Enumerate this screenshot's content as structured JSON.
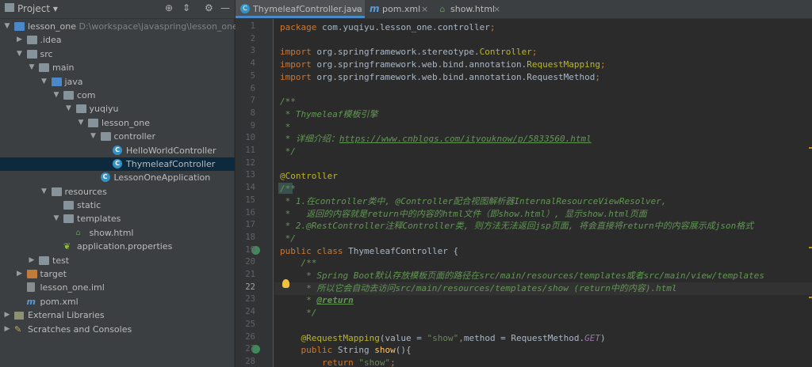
{
  "project_panel": {
    "title": "Project",
    "tree": [
      {
        "label": "lesson_one",
        "path": "D:\\workspace\\javaspring\\lesson_one",
        "icon": "module-folder-icon",
        "arrow": "▼"
      },
      {
        "label": ".idea",
        "icon": "folder-icon",
        "arrow": "▶"
      },
      {
        "label": "src",
        "icon": "folder-icon",
        "arrow": "▼"
      },
      {
        "label": "main",
        "icon": "folder-icon",
        "arrow": "▼"
      },
      {
        "label": "java",
        "icon": "source-folder-icon",
        "arrow": "▼"
      },
      {
        "label": "com",
        "icon": "package-icon",
        "arrow": "▼"
      },
      {
        "label": "yuqiyu",
        "icon": "package-icon",
        "arrow": "▼"
      },
      {
        "label": "lesson_one",
        "icon": "package-icon",
        "arrow": "▼"
      },
      {
        "label": "controller",
        "icon": "package-icon",
        "arrow": "▼"
      },
      {
        "label": "HelloWorldController",
        "icon": "class-icon",
        "arrow": ""
      },
      {
        "label": "ThymeleafController",
        "icon": "class-icon",
        "arrow": "",
        "selected": true
      },
      {
        "label": "LessonOneApplication",
        "icon": "spring-class-icon",
        "arrow": ""
      },
      {
        "label": "resources",
        "icon": "resources-folder-icon",
        "arrow": "▼"
      },
      {
        "label": "static",
        "icon": "folder-icon",
        "arrow": ""
      },
      {
        "label": "templates",
        "icon": "folder-icon",
        "arrow": "▼"
      },
      {
        "label": "show.html",
        "icon": "html-file-icon",
        "arrow": ""
      },
      {
        "label": "application.properties",
        "icon": "properties-file-icon",
        "arrow": ""
      },
      {
        "label": "test",
        "icon": "folder-icon",
        "arrow": "▶"
      },
      {
        "label": "target",
        "icon": "excluded-folder-icon",
        "arrow": "▶"
      },
      {
        "label": "lesson_one.iml",
        "icon": "iml-file-icon",
        "arrow": ""
      },
      {
        "label": "pom.xml",
        "icon": "maven-file-icon",
        "arrow": ""
      },
      {
        "label": "External Libraries",
        "icon": "library-icon",
        "arrow": "▶"
      },
      {
        "label": "Scratches and Consoles",
        "icon": "scratch-icon",
        "arrow": "▶"
      }
    ]
  },
  "tabs": [
    {
      "label": "ThymeleafController.java",
      "active": true
    },
    {
      "label": "pom.xml",
      "active": false
    },
    {
      "label": "show.html",
      "active": false
    }
  ],
  "editor": {
    "current_line": 22,
    "lines": [
      {
        "n": "1",
        "segs": [
          {
            "c": "kw",
            "t": "package "
          },
          {
            "c": "",
            "t": "com.yuqiyu.lesson_one.controller"
          },
          {
            "c": "kw",
            "t": ";"
          }
        ]
      },
      {
        "n": "2",
        "segs": []
      },
      {
        "n": "3",
        "segs": [
          {
            "c": "kw",
            "t": "import "
          },
          {
            "c": "",
            "t": "org.springframework.stereotype."
          },
          {
            "c": "ann",
            "t": "Controller"
          },
          {
            "c": "kw",
            "t": ";"
          }
        ]
      },
      {
        "n": "4",
        "segs": [
          {
            "c": "kw",
            "t": "import "
          },
          {
            "c": "",
            "t": "org.springframework.web.bind.annotation."
          },
          {
            "c": "ann",
            "t": "RequestMapping"
          },
          {
            "c": "kw",
            "t": ";"
          }
        ]
      },
      {
        "n": "5",
        "segs": [
          {
            "c": "kw",
            "t": "import "
          },
          {
            "c": "",
            "t": "org.springframework.web.bind.annotation.RequestMethod"
          },
          {
            "c": "kw",
            "t": ";"
          }
        ]
      },
      {
        "n": "6",
        "segs": []
      },
      {
        "n": "7",
        "segs": [
          {
            "c": "cm",
            "t": "/**"
          }
        ]
      },
      {
        "n": "8",
        "segs": [
          {
            "c": "cm",
            "t": " * Thymeleaf模板引擎"
          }
        ]
      },
      {
        "n": "9",
        "segs": [
          {
            "c": "cm",
            "t": " *"
          }
        ]
      },
      {
        "n": "10",
        "segs": [
          {
            "c": "cm",
            "t": " * 详细介绍："
          },
          {
            "c": "lnk",
            "t": "https://www.cnblogs.com/ityouknow/p/5833560.html"
          }
        ]
      },
      {
        "n": "11",
        "segs": [
          {
            "c": "cm",
            "t": " */"
          }
        ]
      },
      {
        "n": "12",
        "segs": []
      },
      {
        "n": "13",
        "segs": [
          {
            "c": "ann",
            "t": "@Controller"
          }
        ]
      },
      {
        "n": "14",
        "segs": [
          {
            "c": "cm",
            "t": "/**"
          }
        ]
      },
      {
        "n": "15",
        "segs": [
          {
            "c": "cm",
            "t": " * 1.在controller类中, @Controller配合视图解析器InternalResourceViewResolver,"
          }
        ]
      },
      {
        "n": "16",
        "segs": [
          {
            "c": "cm",
            "t": " *   返回的内容就是return中的内容的html文件（即show.html）, 显示show.html页面"
          }
        ]
      },
      {
        "n": "17",
        "segs": [
          {
            "c": "cm",
            "t": " * 2.@RestController注释Controller类, 则方法无法返回jsp页面, 将会直接将return中的内容展示成json格式"
          }
        ]
      },
      {
        "n": "18",
        "segs": [
          {
            "c": "cm",
            "t": " */"
          }
        ]
      },
      {
        "n": "19",
        "segs": [
          {
            "c": "kw",
            "t": "public class "
          },
          {
            "c": "",
            "t": "ThymeleafController {"
          }
        ]
      },
      {
        "n": "20",
        "segs": [
          {
            "c": "cm",
            "t": "    /**"
          }
        ]
      },
      {
        "n": "21",
        "segs": [
          {
            "c": "cm",
            "t": "     * Spring Boot默认存放模板页面的路径在src/main/resources/templates或者src/main/view/templates"
          }
        ]
      },
      {
        "n": "22",
        "segs": [
          {
            "c": "cm",
            "t": "     * 所以它会自动去访问src/main/resources/templates/show (return中的内容).html"
          }
        ]
      },
      {
        "n": "23",
        "segs": [
          {
            "c": "cm",
            "t": "     * "
          },
          {
            "c": "tag",
            "t": "@return"
          }
        ]
      },
      {
        "n": "24",
        "segs": [
          {
            "c": "cm",
            "t": "     */"
          }
        ]
      },
      {
        "n": "25",
        "segs": []
      },
      {
        "n": "26",
        "segs": [
          {
            "c": "ann",
            "t": "    @RequestMapping"
          },
          {
            "c": "",
            "t": "(value = "
          },
          {
            "c": "str",
            "t": "\"show\""
          },
          {
            "c": "kw",
            "t": ","
          },
          {
            "c": "",
            "t": "method = RequestMethod."
          },
          {
            "c": "cnst",
            "t": "GET"
          },
          {
            "c": "",
            "t": ")"
          }
        ]
      },
      {
        "n": "27",
        "segs": [
          {
            "c": "kw",
            "t": "    public "
          },
          {
            "c": "",
            "t": "String "
          },
          {
            "c": "fn",
            "t": "show"
          },
          {
            "c": "",
            "t": "(){"
          }
        ]
      },
      {
        "n": "28",
        "segs": [
          {
            "c": "kw",
            "t": "        return "
          },
          {
            "c": "str",
            "t": "\"show\""
          },
          {
            "c": "kw",
            "t": ";"
          }
        ]
      }
    ]
  }
}
